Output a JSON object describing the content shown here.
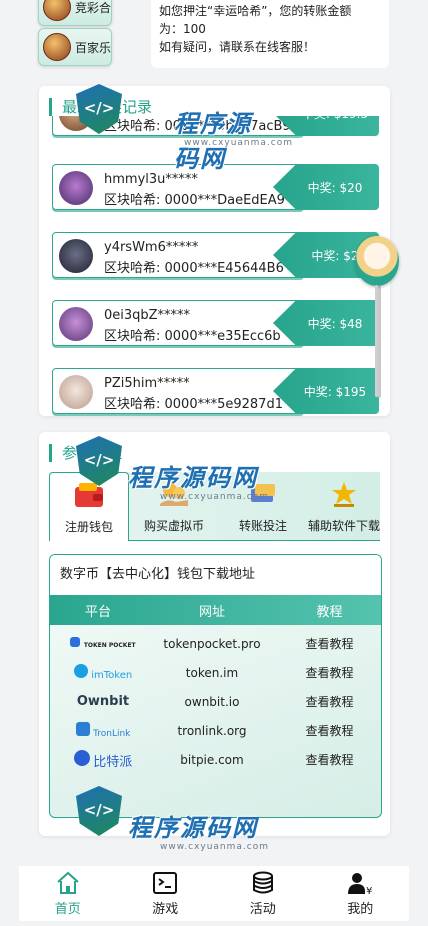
{
  "top": {
    "games": [
      {
        "label": "竞彩合"
      },
      {
        "label": "百家乐"
      }
    ],
    "notice_lines": [
      "如您押注“幸运哈希”，您的转账金额",
      "为：100",
      "如有疑问，请联系在线客服！"
    ]
  },
  "winners": {
    "title": "最新中奖记录",
    "rows": [
      {
        "name": "",
        "hash": "区块哈希: 0000***0bE27acB9",
        "prize": "中奖: $19.5"
      },
      {
        "name": "hmmyl3u*****",
        "hash": "区块哈希: 0000***DaeEdEA9",
        "prize": "中奖: $20"
      },
      {
        "name": "y4rsWm6*****",
        "hash": "区块哈希: 0000***E45644B6",
        "prize": "中奖: $2"
      },
      {
        "name": "0ei3qbZ*****",
        "hash": "区块哈希: 0000***e35Ecc6b",
        "prize": "中奖: $48"
      },
      {
        "name": "PZi5him*****",
        "hash": "区块哈希: 0000***5e9287d1",
        "prize": "中奖: $195"
      }
    ]
  },
  "wallet": {
    "title": "参与流程",
    "tabs": [
      {
        "label": "注册钱包",
        "icon": "wallet-icon"
      },
      {
        "label": "购买虚拟币",
        "icon": "coins-hand-icon"
      },
      {
        "label": "转账投注",
        "icon": "transfer-icon"
      },
      {
        "label": "辅助软件下载",
        "icon": "trophy-icon"
      }
    ],
    "box_title": "数字币【去中心化】钱包下载地址",
    "columns": [
      "平台",
      "网址",
      "教程"
    ],
    "rows": [
      {
        "logo": "TOKEN POCKET",
        "url": "tokenpocket.pro",
        "action": "查看教程"
      },
      {
        "logo": "imToken",
        "url": "token.im",
        "action": "查看教程"
      },
      {
        "logo": "Ownbit",
        "url": "ownbit.io",
        "action": "查看教程"
      },
      {
        "logo": "TronLink",
        "url": "tronlink.org",
        "action": "查看教程"
      },
      {
        "logo": "比特派",
        "url": "bitpie.com",
        "action": "查看教程"
      }
    ]
  },
  "watermark": {
    "text": "程序源码网",
    "sub": "www.cxyuanma.com"
  },
  "nav": [
    {
      "label": "首页",
      "icon": "home-icon"
    },
    {
      "label": "游戏",
      "icon": "game-console-icon"
    },
    {
      "label": "活动",
      "icon": "coin-stack-icon"
    },
    {
      "label": "我的",
      "icon": "user-icon"
    }
  ],
  "colors": {
    "accent": "#25a38b",
    "watermark": "#1f6fb3"
  }
}
